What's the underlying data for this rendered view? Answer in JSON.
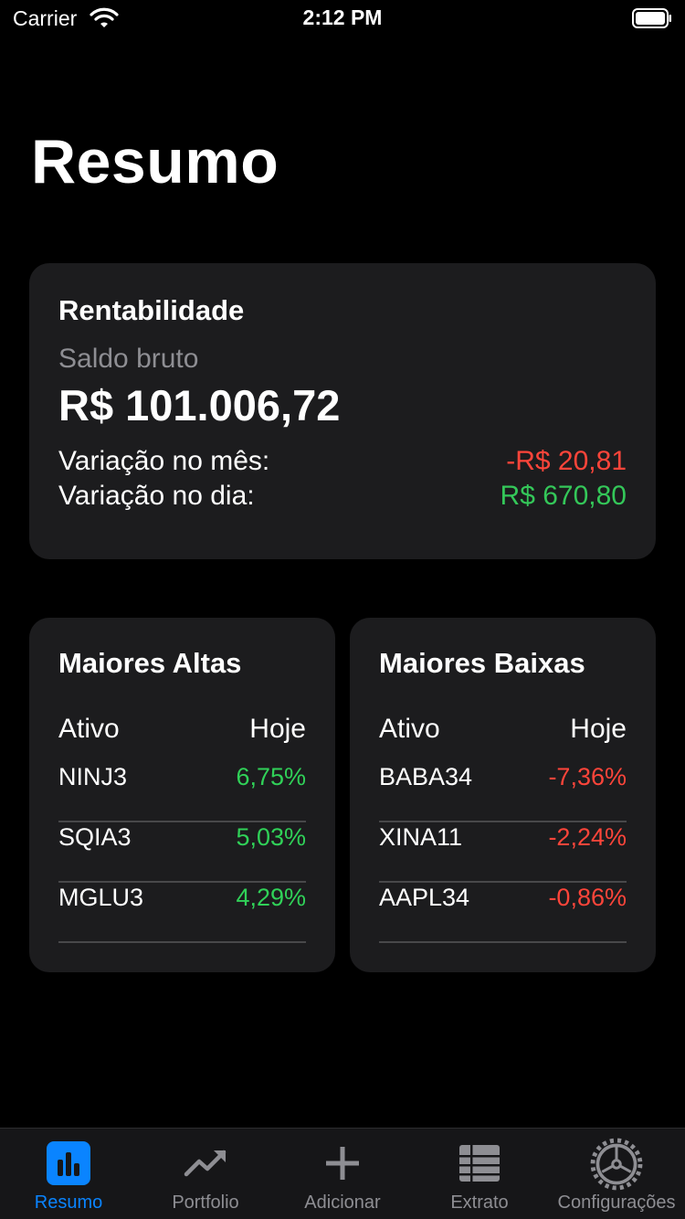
{
  "status_bar": {
    "carrier": "Carrier",
    "time": "2:12 PM"
  },
  "page": {
    "title": "Resumo"
  },
  "rentabilidade": {
    "title": "Rentabilidade",
    "saldo_label": "Saldo bruto",
    "saldo_value": "R$ 101.006,72",
    "variacao_mes_label": "Variação no mês:",
    "variacao_mes_value": "-R$ 20,81",
    "variacao_dia_label": "Variação no dia:",
    "variacao_dia_value": "R$ 670,80"
  },
  "maiores_altas": {
    "title": "Maiores Altas",
    "col_asset": "Ativo",
    "col_today": "Hoje",
    "rows": [
      {
        "ticker": "NINJ3",
        "change": "6,75%"
      },
      {
        "ticker": "SQIA3",
        "change": "5,03%"
      },
      {
        "ticker": "MGLU3",
        "change": "4,29%"
      }
    ]
  },
  "maiores_baixas": {
    "title": "Maiores Baixas",
    "col_asset": "Ativo",
    "col_today": "Hoje",
    "rows": [
      {
        "ticker": "BABA34",
        "change": "-7,36%"
      },
      {
        "ticker": "XINA11",
        "change": "-2,24%"
      },
      {
        "ticker": "AAPL34",
        "change": "-0,86%"
      }
    ]
  },
  "tab_bar": {
    "items": [
      {
        "label": "Resumo",
        "icon": "bar-chart-icon",
        "active": true
      },
      {
        "label": "Portfolio",
        "icon": "trend-up-icon",
        "active": false
      },
      {
        "label": "Adicionar",
        "icon": "plus-icon",
        "active": false
      },
      {
        "label": "Extrato",
        "icon": "list-icon",
        "active": false
      },
      {
        "label": "Configurações",
        "icon": "gear-icon",
        "active": false
      }
    ]
  },
  "colors": {
    "accent": "#0a84ff",
    "positive": "#30d158",
    "negative": "#ff453a",
    "card": "#1c1c1e",
    "background": "#000000"
  }
}
